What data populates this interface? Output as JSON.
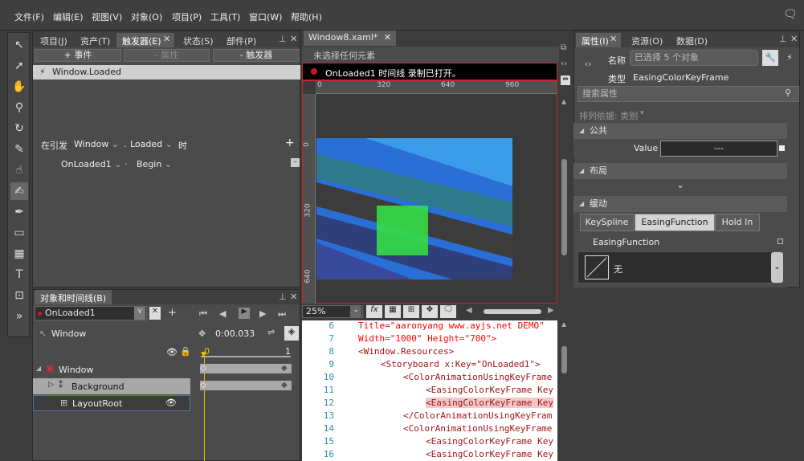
{
  "menu": [
    "文件(F)",
    "编辑(E)",
    "视图(V)",
    "对象(O)",
    "项目(P)",
    "工具(T)",
    "窗口(W)",
    "帮助(H)"
  ],
  "left_panel": {
    "tabs": [
      "项目(J)",
      "资产(T)",
      "触发器(E)",
      "状态(S)",
      "部件(P)"
    ],
    "active_tab": "触发器(E)",
    "buttons": [
      "+ 事件",
      "- 属性",
      "- 触发器"
    ],
    "trigger_item": "Window.Loaded",
    "when_label": "在引发",
    "when_source": "Window",
    "when_dot": ".",
    "when_event": "Loaded",
    "when_suffix": "时",
    "action_storyboard": "OnLoaded1",
    "action_dot": "·",
    "action_verb": "Begin",
    "add_glyph": "+",
    "remove_glyph": "–"
  },
  "objects_panel": {
    "title": "对象和时间线(B)",
    "storyboard": "OnLoaded1",
    "root_label": "Window",
    "time": "0:00.033",
    "ruler": [
      "0",
      "1"
    ],
    "tree": [
      {
        "label": "Window"
      },
      {
        "label": "Background"
      },
      {
        "label": "LayoutRoot"
      }
    ]
  },
  "document": {
    "tab": "Window8.xaml*",
    "status": "未选择任何元素",
    "recording": "OnLoaded1 时间线 录制已打开。",
    "ruler_top": [
      "0",
      "320",
      "640",
      "960"
    ],
    "ruler_left": [
      "0",
      "320",
      "640"
    ],
    "zoom": "25%",
    "fx_label": "fx"
  },
  "code": [
    {
      "n": "6",
      "text": "Title=\"aaronyang www.ayjs.net DEMO\""
    },
    {
      "n": "7",
      "text": "Width=\"1000\" Height=\"700\">"
    },
    {
      "n": "8",
      "text": "<Window.Resources>"
    },
    {
      "n": "9",
      "text": "<Storyboard x:Key=\"OnLoaded1\">"
    },
    {
      "n": "10",
      "text": "<ColorAnimationUsingKeyFrame"
    },
    {
      "n": "11",
      "text": "<EasingColorKeyFrame Key"
    },
    {
      "n": "12",
      "text": "<EasingColorKeyFrame Key"
    },
    {
      "n": "13",
      "text": "</ColorAnimationUsingKeyFram"
    },
    {
      "n": "14",
      "text": "<ColorAnimationUsingKeyFrame"
    },
    {
      "n": "15",
      "text": "<EasingColorKeyFrame Key"
    },
    {
      "n": "16",
      "text": "<EasingColorKeyFrame Key"
    }
  ],
  "properties": {
    "tabs": [
      "属性(I)",
      "资源(O)",
      "数据(D)"
    ],
    "name_label": "名称",
    "name_value": "已选择 5 个对象",
    "type_label": "类型",
    "type_value": "EasingColorKeyFrame",
    "search_placeholder": "搜索属性",
    "arrange": "排列依据: 类别",
    "section_common": "公共",
    "value_label": "Value",
    "value_text": "---",
    "section_layout": "布局",
    "section_easing": "缓动",
    "easing_tabs": [
      "KeySpline",
      "EasingFunction",
      "Hold In"
    ],
    "easing_function_label": "EasingFunction",
    "easing_none": "无"
  },
  "colors": {
    "accent": "#4e9bd6",
    "record_red": "#cc1a1a",
    "highlight_green": "#33dd44"
  }
}
